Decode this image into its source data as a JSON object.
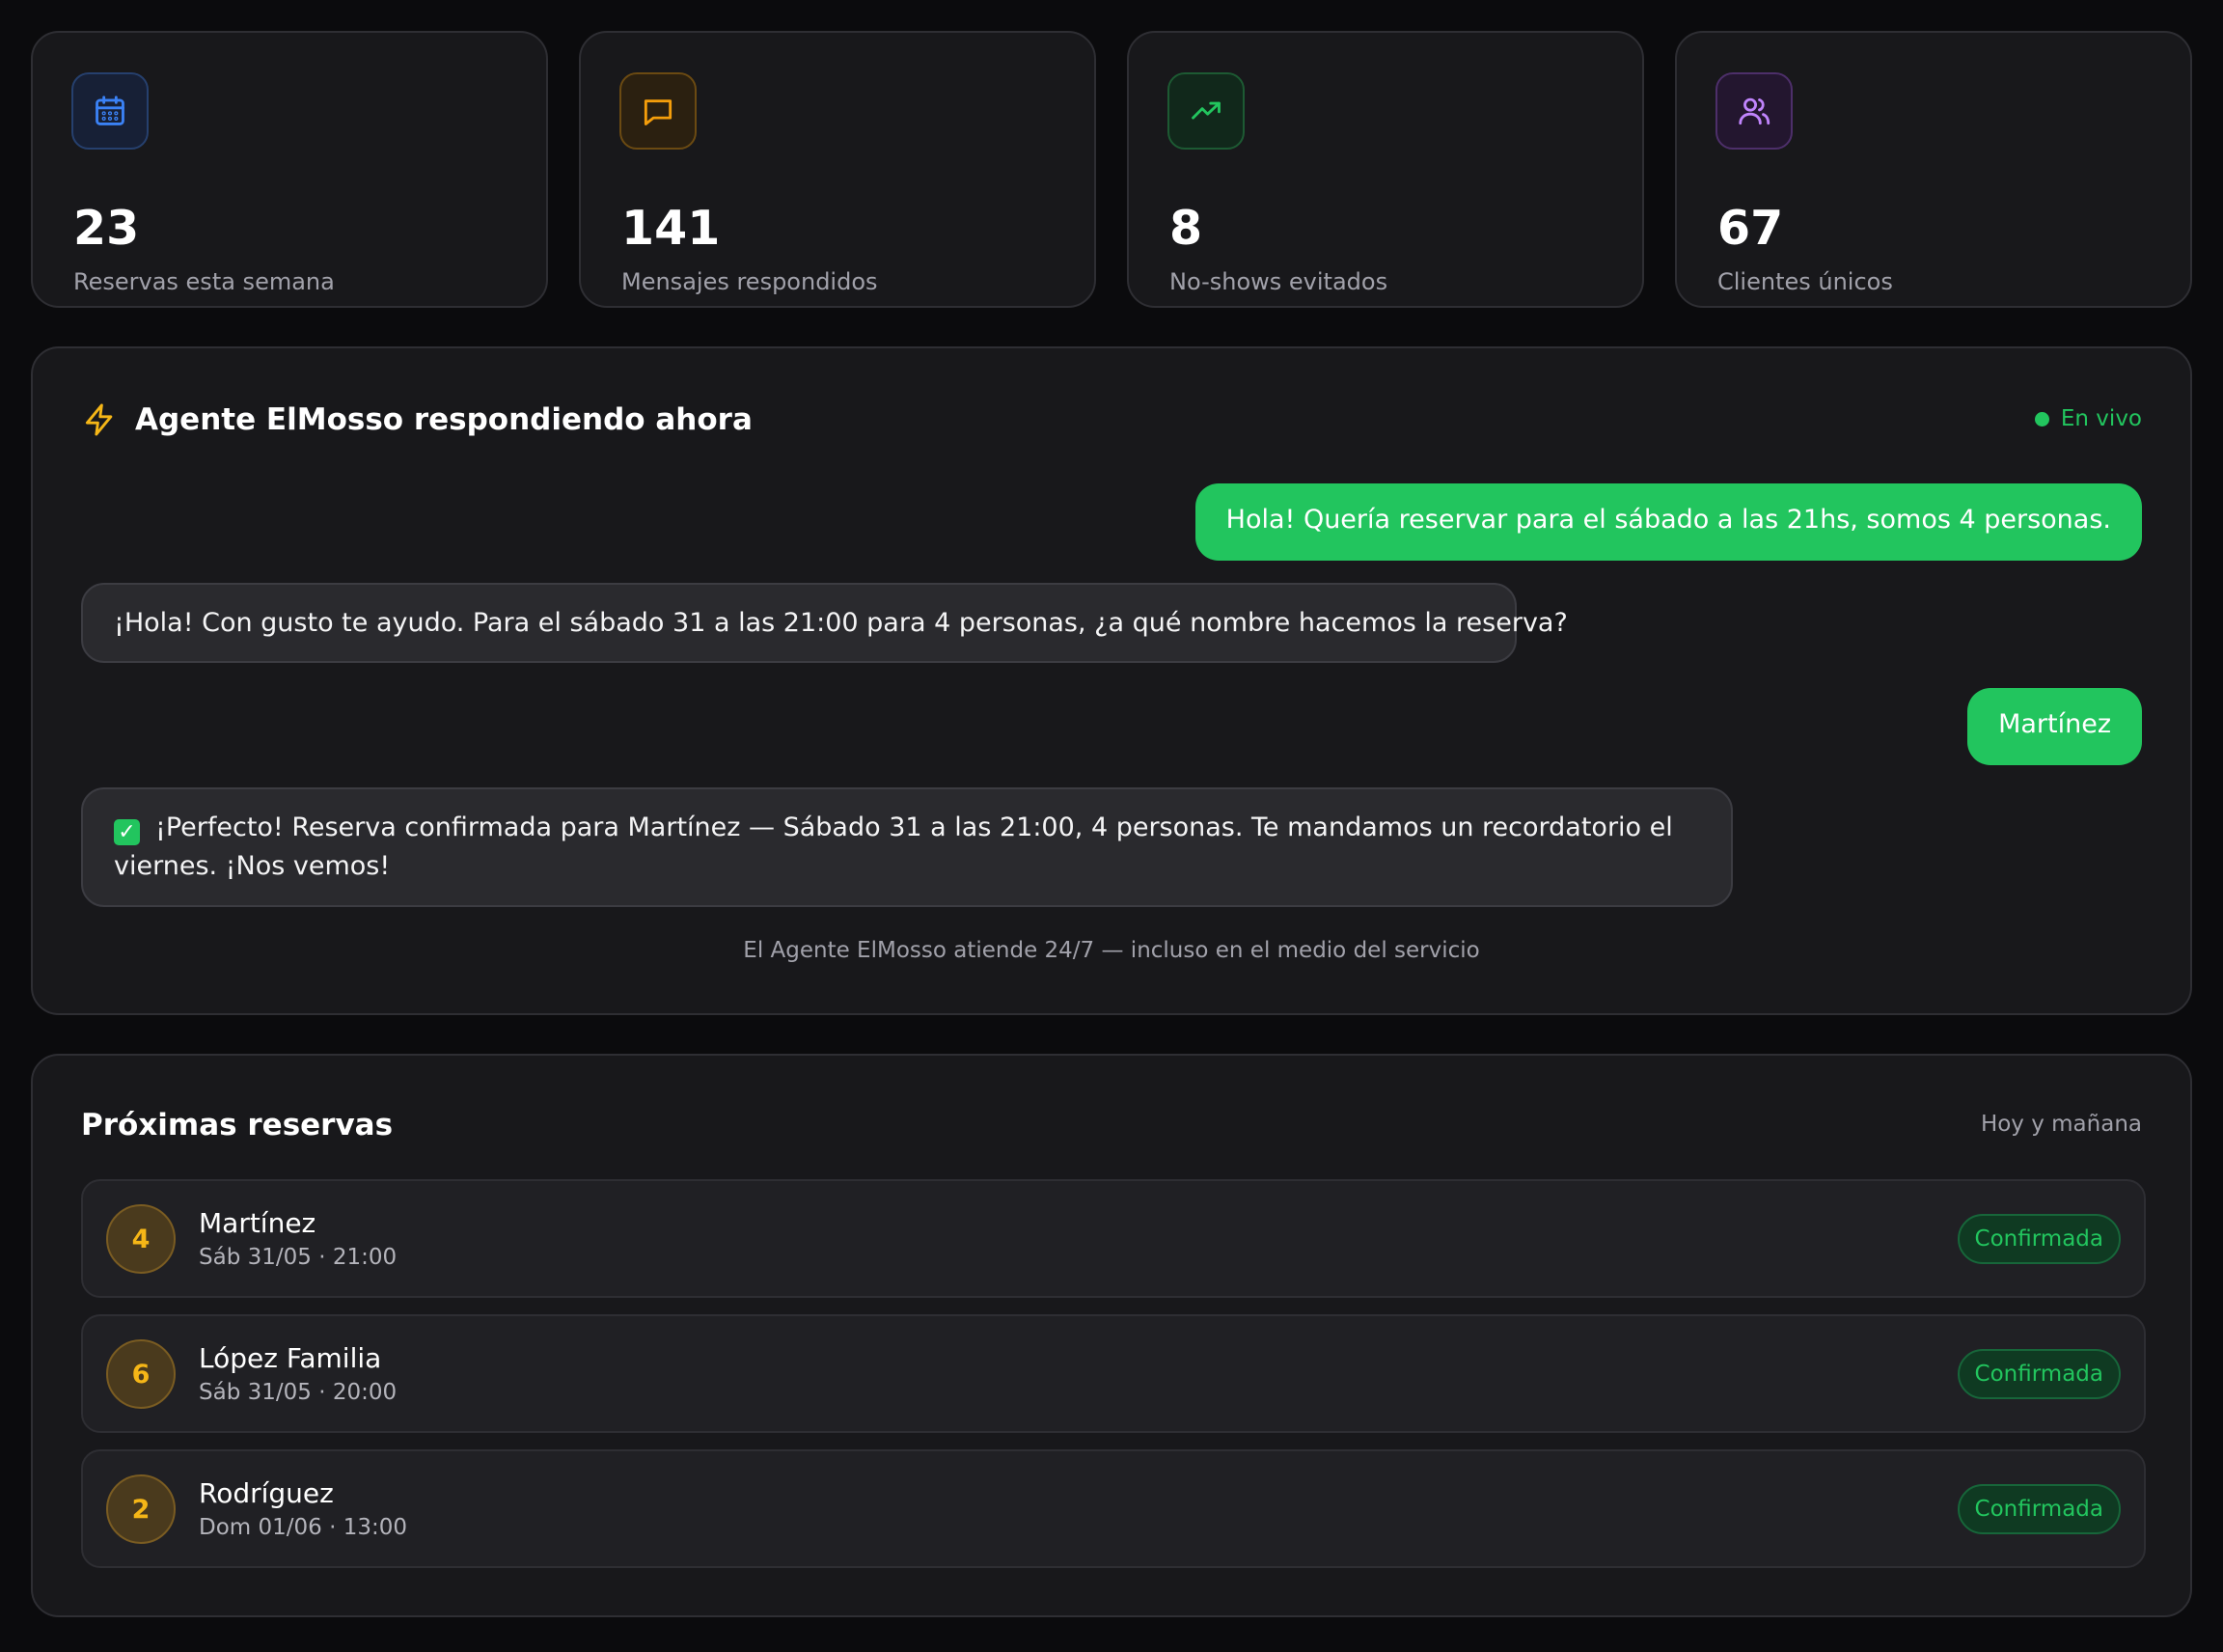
{
  "stats": [
    {
      "value": "23",
      "label": "Reservas esta semana",
      "icon": "calendar-icon",
      "color": "#3b82f6"
    },
    {
      "value": "141",
      "label": "Mensajes respondidos",
      "icon": "message-square-icon",
      "color": "#f59e0b"
    },
    {
      "value": "8",
      "label": "No-shows evitados",
      "icon": "trending-up-icon",
      "color": "#22c55e"
    },
    {
      "value": "67",
      "label": "Clientes únicos",
      "icon": "users-icon",
      "color": "#a855f7"
    }
  ],
  "agent": {
    "title": "Agente ElMosso respondiendo ahora",
    "status": "En vivo",
    "messages": [
      {
        "from": "user",
        "text": "Hola! Quería reservar para el sábado a las 21hs, somos 4 personas."
      },
      {
        "from": "agent",
        "text": "¡Hola! Con gusto te ayudo. Para el sábado 31 a las 21:00 para 4 personas, ¿a qué nombre hacemos la reserva?"
      },
      {
        "from": "user",
        "text": "Martínez"
      },
      {
        "from": "agent",
        "text": "¡Perfecto! Reserva confirmada para Martínez — Sábado 31 a las 21:00, 4 personas. Te mandamos un recordatorio el viernes. ¡Nos vemos!"
      }
    ],
    "footer": "El Agente ElMosso atiende 24/7 — incluso en el medio del servicio"
  },
  "reservations": {
    "title": "Próximas reservas",
    "subtitle": "Hoy y mañana",
    "items": [
      {
        "party": "4",
        "name": "Martínez",
        "when": "Sáb 31/05 · 21:00",
        "status": "Confirmada"
      },
      {
        "party": "6",
        "name": "López Familia",
        "when": "Sáb 31/05 · 20:00",
        "status": "Confirmada"
      },
      {
        "party": "2",
        "name": "Rodríguez",
        "when": "Dom 01/06 · 13:00",
        "status": "Confirmada"
      }
    ]
  },
  "colors": {
    "accent_green": "#22c55e",
    "amber": "#f5b617",
    "background": "#0b0b0d",
    "card": "#18181b"
  }
}
